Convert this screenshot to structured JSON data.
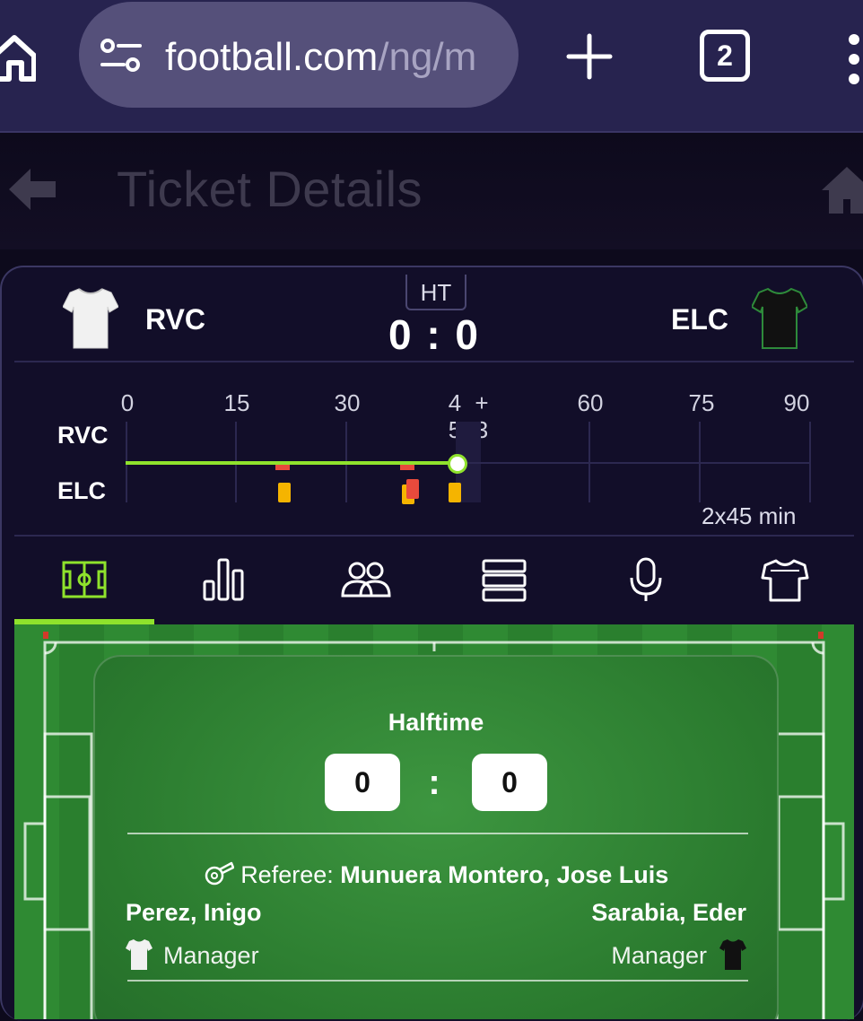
{
  "browser": {
    "url_host": "football.com",
    "url_path": "/ng/m",
    "tab_count": "2"
  },
  "header": {
    "title": "Ticket Details"
  },
  "match": {
    "status_badge": "HT",
    "home_team": "RVC",
    "away_team": "ELC",
    "score": "0 : 0"
  },
  "timeline": {
    "ticks": [
      "0",
      "15",
      "30",
      "4\n5",
      "+\n3",
      "60",
      "75",
      "90"
    ],
    "row_labels": [
      "RVC",
      "ELC"
    ],
    "duration": "2x45 min",
    "elapsed_minutes": 48,
    "events": [
      {
        "team": "ELC",
        "minute": 21,
        "type": "yellow-card"
      },
      {
        "team": "ELC",
        "minute": 38,
        "type": "second-yellow-red-card"
      },
      {
        "team": "ELC",
        "minute": 45,
        "type": "yellow-card"
      }
    ]
  },
  "tabs": [
    {
      "name": "pitch-icon",
      "active": true
    },
    {
      "name": "stats-icon",
      "active": false
    },
    {
      "name": "lineups-icon",
      "active": false
    },
    {
      "name": "table-icon",
      "active": false
    },
    {
      "name": "commentary-icon",
      "active": false
    },
    {
      "name": "jersey-icon",
      "active": false
    }
  ],
  "summary": {
    "period": "Halftime",
    "home_score": "0",
    "away_score": "0",
    "referee_label": "Referee:",
    "referee_name": "Munuera Montero, Jose Luis",
    "home_manager": "Perez, Inigo",
    "away_manager": "Sarabia, Eder",
    "manager_role": "Manager"
  },
  "colors": {
    "accent": "#8fe22c",
    "card_bg": "#120e29",
    "chrome_bg": "#27234f",
    "yellow_card": "#f5b400",
    "red_card": "#e84a3c"
  }
}
